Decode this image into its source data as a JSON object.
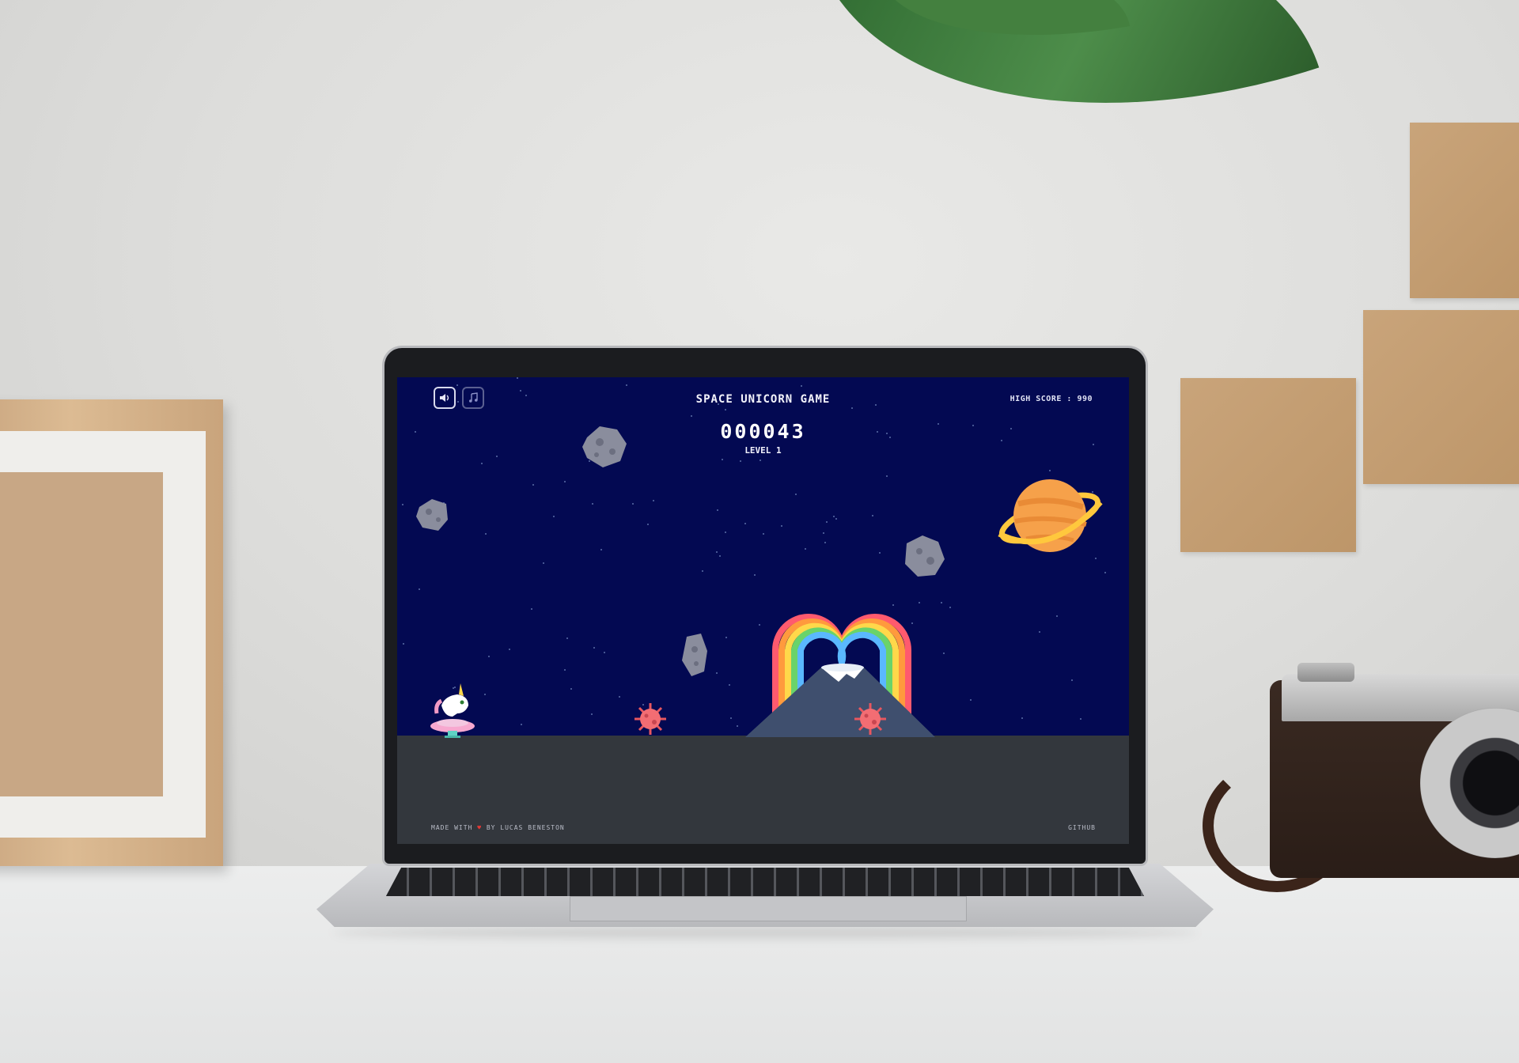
{
  "game": {
    "title": "SPACE UNICORN GAME",
    "high_score_label": "HIGH SCORE",
    "high_score_value": "990",
    "score": "000043",
    "level": "LEVEL 1",
    "sound_icon": "speaker-icon",
    "music_icon": "music-note-icon"
  },
  "footer": {
    "made_with": "MADE WITH",
    "by": "BY LUCAS BENESTON",
    "github": "GITHUB"
  },
  "colors": {
    "space_background": "#030952",
    "ground": "#33373d",
    "planet": "#f6a14a",
    "planet_ring": "#ffc83d",
    "heart": "#e53935"
  }
}
